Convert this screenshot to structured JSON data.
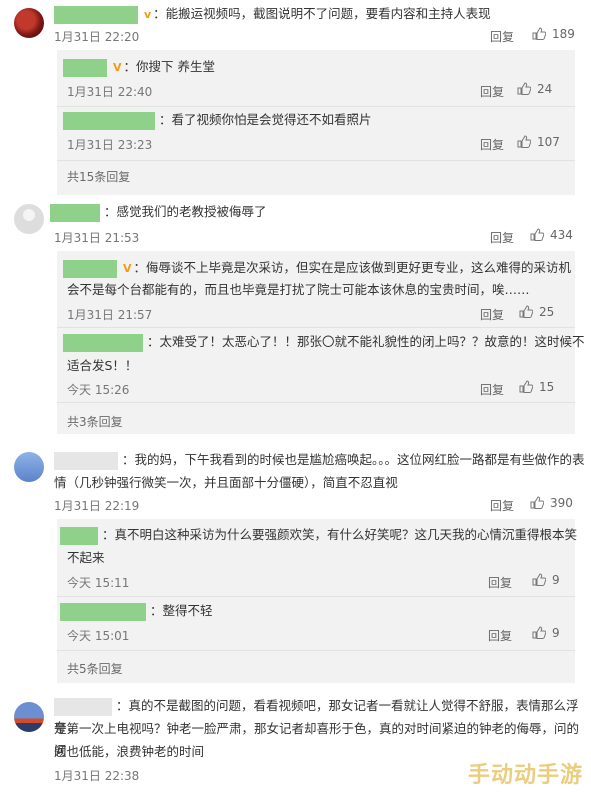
{
  "comments": [
    {
      "text": "：能搬运视频吗，截图说明不了问题，要看内容和主持人表现",
      "time": "1月31日 22:20",
      "reply": "回复",
      "likes": "189"
    },
    {
      "text": "：你搜下 养生堂",
      "time": "1月31日 22:40",
      "reply": "回复",
      "likes": "24"
    },
    {
      "text": "：看了视频你怕是会觉得还不如看照片",
      "time": "1月31日 23:23",
      "reply": "回复",
      "likes": "107"
    },
    {
      "more": "共15条回复"
    },
    {
      "text": "：感觉我们的老教授被侮辱了",
      "time": "1月31日 21:53",
      "reply": "回复",
      "likes": "434"
    },
    {
      "text1": "：侮辱谈不上毕竟是次采访，但实在是应该做到更好更专业，这么难得的采访机",
      "text2": "会不是每个台都能有的，而且也毕竟是打扰了院士可能本该休息的宝贵时间，唉……",
      "time": "1月31日 21:57",
      "reply": "回复",
      "likes": "25"
    },
    {
      "text1": "：太难受了！太恶心了！！那张〇就不能礼貌性的闭上吗？？故意的！这时候不",
      "text2": "适合发S！！",
      "time": "今天 15:26",
      "reply": "回复",
      "likes": "15"
    },
    {
      "more": "共3条回复"
    },
    {
      "text1": "：我的妈，下午我看到的时候也是尴尬癌唤起。。。这位网红脸一路都是有些做作的表",
      "text2": "情（几秒钟强行微笑一次，并且面部十分僵硬），简直不忍直视",
      "time": "1月31日 22:19",
      "reply": "回复",
      "likes": "390"
    },
    {
      "text1": "：真不明白这种采访为什么要强颜欢笑，有什么好笑呢？这几天我的心情沉重得根本笑",
      "text2": "不起来",
      "time": "今天 15:11",
      "reply": "回复",
      "likes": "9"
    },
    {
      "text": "：整得不轻",
      "time": "今天 15:01",
      "reply": "回复",
      "likes": "9"
    },
    {
      "more": "共5条回复"
    },
    {
      "text1": "：真的不是截图的问题，看看视频吧，那女记者一看就让人觉得不舒服，表情那么浮夸，",
      "text2": "是第一次上电视吗？钟老一脸严肃，那女记者却喜形于色，真的对时间紧迫的钟老的侮辱，问的问",
      "text3": "题也低能，浪费钟老的时间",
      "time": "1月31日 22:38"
    }
  ],
  "watermark": "手动动手游",
  "colors": {
    "mask": "#8fd18a",
    "reply_bg": "#f2f2f2",
    "badge": "#f39b12"
  }
}
